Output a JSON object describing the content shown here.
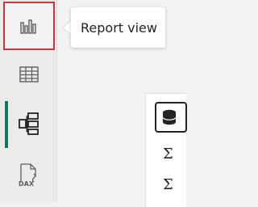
{
  "rail": {
    "items": [
      {
        "name": "report-view-button",
        "icon": "bar-chart-icon",
        "selected": true
      },
      {
        "name": "table-view-button",
        "icon": "table-grid-icon",
        "selected": false
      },
      {
        "name": "model-view-button",
        "icon": "model-diagram-icon",
        "selected": false,
        "active": true
      },
      {
        "name": "dax-query-view-button",
        "icon": "dax-icon",
        "selected": false
      }
    ],
    "dax_label": "DAX"
  },
  "tooltip": {
    "text": "Report view"
  },
  "fields_pane": {
    "icon": "database-icon",
    "sigma_1": "Σ",
    "sigma_2": "Σ"
  },
  "colors": {
    "selection_border": "#d13438",
    "active_bar": "#117865",
    "icon": "#605e5c"
  }
}
